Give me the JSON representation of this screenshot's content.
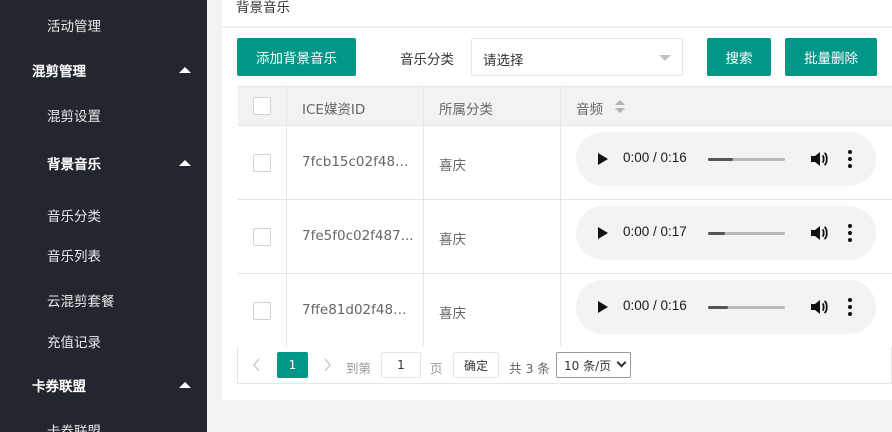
{
  "sidebar": {
    "items": [
      {
        "label": "活动管理",
        "type": "sub"
      },
      {
        "label": "混剪管理",
        "type": "group",
        "expanded": true
      },
      {
        "label": "混剪设置",
        "type": "sub"
      },
      {
        "label": "背景音乐",
        "type": "subgroup",
        "expanded": true
      },
      {
        "label": "音乐分类",
        "type": "sub"
      },
      {
        "label": "音乐列表",
        "type": "sub"
      },
      {
        "label": "云混剪套餐",
        "type": "sub"
      },
      {
        "label": "充值记录",
        "type": "sub"
      },
      {
        "label": "卡券联盟",
        "type": "group",
        "expanded": true
      },
      {
        "label": "卡券联盟",
        "type": "sub"
      }
    ]
  },
  "page": {
    "title": "背景音乐"
  },
  "toolbar": {
    "add_label": "添加背景音乐",
    "category_label": "音乐分类",
    "category_value": "请选择",
    "search_label": "搜索",
    "batch_delete_label": "批量删除"
  },
  "table": {
    "headers": {
      "id": "ICE媒资ID",
      "category": "所属分类",
      "audio": "音频"
    },
    "rows": [
      {
        "id": "7fcb15c02f487...",
        "category": "喜庆",
        "time": "0:00 / 0:16",
        "progress": 0.32
      },
      {
        "id": "7fe5f0c02f487...",
        "category": "喜庆",
        "time": "0:00 / 0:17",
        "progress": 0.22
      },
      {
        "id": "7ffe81d02f487...",
        "category": "喜庆",
        "time": "0:00 / 0:16",
        "progress": 0.26
      }
    ]
  },
  "pagination": {
    "current_page": "1",
    "goto_prefix": "到第",
    "goto_value": "1",
    "goto_suffix": "页",
    "confirm_label": "确定",
    "total_label": "共 3 条",
    "page_size": "10 条/页"
  },
  "colors": {
    "accent": "#009688",
    "sidebar_bg": "#23262e"
  },
  "icons": [
    "chevron-up-icon",
    "caret-down-icon",
    "sort-icon",
    "play-icon",
    "volume-icon",
    "more-vertical-icon",
    "chevron-left-icon",
    "chevron-right-icon"
  ]
}
